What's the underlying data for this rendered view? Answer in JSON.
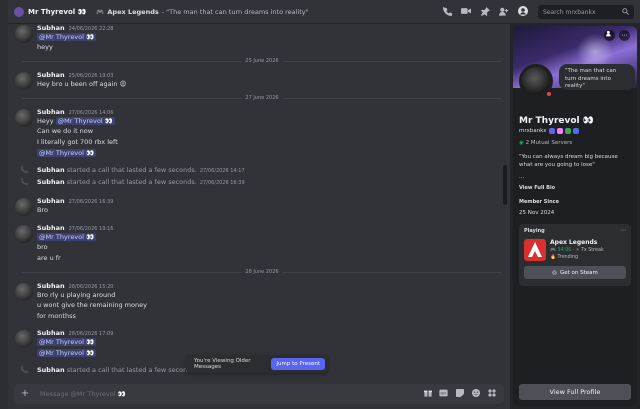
{
  "header": {
    "dm_name": "Mr Thyrevol 👀",
    "status_game": "Apex Legends",
    "status_quote": "- \"The man that can turn dreams into reality\"",
    "search_placeholder": "Search mrxbankx",
    "icons": [
      "phone-icon",
      "video-icon",
      "pin-icon",
      "add-friend-icon",
      "user-profile-icon",
      "search-icon"
    ]
  },
  "messages": [
    {
      "user": "Subhan",
      "time": "24/06/2026 22:28",
      "lines": [
        "@Mr Thyrevol 👀",
        "heyy"
      ],
      "mention_first": true
    },
    {
      "divider": "25 June 2026"
    },
    {
      "user": "Subhan",
      "time": "25/06/2026 19:03",
      "lines": [
        "Hey bro u been off again 😩"
      ]
    },
    {
      "divider": "27 June 2026"
    },
    {
      "user": "Subhan",
      "time": "27/06/2026 14:06",
      "lines": [
        "Heyy",
        "Can we do it now",
        "I literally got 700 rbx left",
        "@Mr Thyrevol 👀"
      ],
      "inline_mention": "@Mr Thyrevol 👀"
    },
    {
      "call": true,
      "user": "Subhan",
      "text": "started a call that lasted a few seconds.",
      "time": "27/06/2026 14:17"
    },
    {
      "call": true,
      "user": "Subhan",
      "text": "started a call that lasted a few seconds.",
      "time": "27/06/2026 16:39"
    },
    {
      "user": "Subhan",
      "time": "27/06/2026 16:39",
      "lines": [
        "Bro"
      ]
    },
    {
      "user": "Subhan",
      "time": "27/06/2026 19:16",
      "lines": [
        "@Mr Thyrevol 👀",
        "bro",
        "are u fr"
      ]
    },
    {
      "divider": "28 June 2026"
    },
    {
      "user": "Subhan",
      "time": "28/06/2026 15:20",
      "lines": [
        "Bro rly u playing around",
        "u wont give the remaining money",
        "for monthss"
      ]
    },
    {
      "user": "Subhan",
      "time": "28/06/2026 17:09",
      "lines": [
        "@Mr Thyrevol 👀",
        "@Mr Thyrevol 👀"
      ]
    },
    {
      "call": true,
      "user": "Subhan",
      "text": "started a call that lasted a few seconds.",
      "time": "28/06/"
    }
  ],
  "older_bar": {
    "text": "You're Viewing Older Messages",
    "button": "Jump to Present"
  },
  "input": {
    "placeholder": "Message @Mr Thyrevol 👀"
  },
  "profile": {
    "display_name": "Mr Thyrevol 👀",
    "username": "mrxbankx",
    "bubble": "\"The man that can turn dreams into reality\"",
    "mutual": "2 Mutual Servers",
    "bio": "\"You can always dream big because what are you going to lose\"",
    "bio_more": "...",
    "view_full_bio": "View Full Bio",
    "member_since_label": "Member Since",
    "member_since": "25 Nov 2024",
    "activity_label": "Playing",
    "game": "Apex Legends",
    "game_time": "34:06",
    "game_streak": "7x Streak",
    "game_trending": "Trending",
    "steam_button": "Get on Steam",
    "full_profile_button": "View Full Profile"
  }
}
